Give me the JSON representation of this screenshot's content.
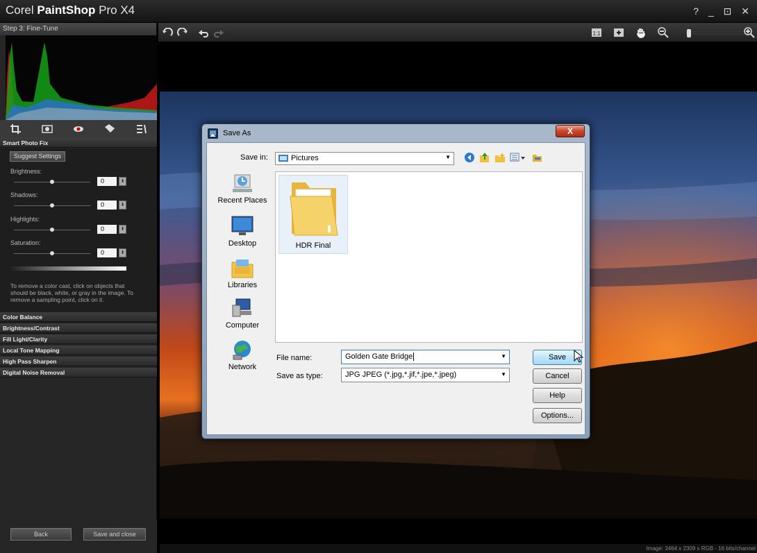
{
  "app": {
    "title_prefix": "Corel ",
    "title_bold": "PaintShop",
    "title_suffix": " Pro X4",
    "window_controls": "? _ ⊡ ✕"
  },
  "left_panel": {
    "step_label": "Step 3: Fine-Tune",
    "smart_photo_fix": {
      "header": "Smart Photo Fix",
      "suggest_button": "Suggest Settings",
      "sliders": [
        {
          "label": "Brightness:",
          "value": "0",
          "level": 0.5
        },
        {
          "label": "Shadows:",
          "value": "0",
          "level": 0.5
        },
        {
          "label": "Highlights:",
          "value": "0",
          "level": 0.5
        },
        {
          "label": "Saturation:",
          "value": "0",
          "level": 0.5
        }
      ],
      "help_text": "To remove a color cast, click on objects that should be black, white, or gray in the image. To remove a sampling point, click on it."
    },
    "sections": [
      "Color Balance",
      "Brightness/Contrast",
      "Fill Light/Clarity",
      "Local Tone Mapping",
      "High Pass Sharpen",
      "Digital Noise Removal"
    ],
    "back_button": "Back",
    "save_close_button": "Save and close"
  },
  "toolbar": {
    "zoom_level": 0.0
  },
  "status_bar": "Image: 3464 x 2309 x RGB - 16 bits/channel",
  "dialog": {
    "title": "Save As",
    "close_label": "X",
    "save_in_label": "Save in:",
    "save_in_value": "Pictures",
    "places": [
      "Recent Places",
      "Desktop",
      "Libraries",
      "Computer",
      "Network"
    ],
    "folder_name": "HDR Final",
    "file_name_label": "File name:",
    "file_name_value": "Golden Gate Bridge",
    "save_type_label": "Save as type:",
    "save_type_value": "JPG JPEG  (*.jpg,*.jif,*.jpe,*.jpeg)",
    "buttons": {
      "save": "Save",
      "cancel": "Cancel",
      "help": "Help",
      "options": "Options..."
    }
  }
}
